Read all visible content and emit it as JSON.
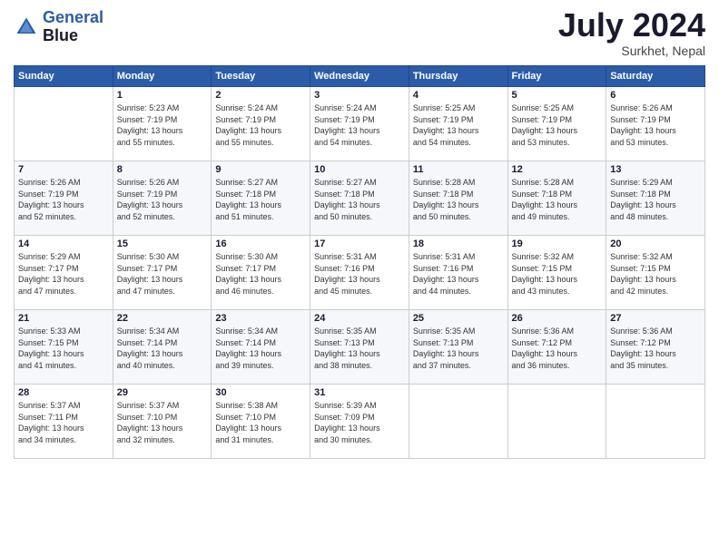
{
  "header": {
    "logo_line1": "General",
    "logo_line2": "Blue",
    "month": "July 2024",
    "location": "Surkhet, Nepal"
  },
  "weekdays": [
    "Sunday",
    "Monday",
    "Tuesday",
    "Wednesday",
    "Thursday",
    "Friday",
    "Saturday"
  ],
  "weeks": [
    [
      {
        "day": "",
        "info": ""
      },
      {
        "day": "1",
        "info": "Sunrise: 5:23 AM\nSunset: 7:19 PM\nDaylight: 13 hours\nand 55 minutes."
      },
      {
        "day": "2",
        "info": "Sunrise: 5:24 AM\nSunset: 7:19 PM\nDaylight: 13 hours\nand 55 minutes."
      },
      {
        "day": "3",
        "info": "Sunrise: 5:24 AM\nSunset: 7:19 PM\nDaylight: 13 hours\nand 54 minutes."
      },
      {
        "day": "4",
        "info": "Sunrise: 5:25 AM\nSunset: 7:19 PM\nDaylight: 13 hours\nand 54 minutes."
      },
      {
        "day": "5",
        "info": "Sunrise: 5:25 AM\nSunset: 7:19 PM\nDaylight: 13 hours\nand 53 minutes."
      },
      {
        "day": "6",
        "info": "Sunrise: 5:26 AM\nSunset: 7:19 PM\nDaylight: 13 hours\nand 53 minutes."
      }
    ],
    [
      {
        "day": "7",
        "info": "Sunrise: 5:26 AM\nSunset: 7:19 PM\nDaylight: 13 hours\nand 52 minutes."
      },
      {
        "day": "8",
        "info": "Sunrise: 5:26 AM\nSunset: 7:19 PM\nDaylight: 13 hours\nand 52 minutes."
      },
      {
        "day": "9",
        "info": "Sunrise: 5:27 AM\nSunset: 7:18 PM\nDaylight: 13 hours\nand 51 minutes."
      },
      {
        "day": "10",
        "info": "Sunrise: 5:27 AM\nSunset: 7:18 PM\nDaylight: 13 hours\nand 50 minutes."
      },
      {
        "day": "11",
        "info": "Sunrise: 5:28 AM\nSunset: 7:18 PM\nDaylight: 13 hours\nand 50 minutes."
      },
      {
        "day": "12",
        "info": "Sunrise: 5:28 AM\nSunset: 7:18 PM\nDaylight: 13 hours\nand 49 minutes."
      },
      {
        "day": "13",
        "info": "Sunrise: 5:29 AM\nSunset: 7:18 PM\nDaylight: 13 hours\nand 48 minutes."
      }
    ],
    [
      {
        "day": "14",
        "info": "Sunrise: 5:29 AM\nSunset: 7:17 PM\nDaylight: 13 hours\nand 47 minutes."
      },
      {
        "day": "15",
        "info": "Sunrise: 5:30 AM\nSunset: 7:17 PM\nDaylight: 13 hours\nand 47 minutes."
      },
      {
        "day": "16",
        "info": "Sunrise: 5:30 AM\nSunset: 7:17 PM\nDaylight: 13 hours\nand 46 minutes."
      },
      {
        "day": "17",
        "info": "Sunrise: 5:31 AM\nSunset: 7:16 PM\nDaylight: 13 hours\nand 45 minutes."
      },
      {
        "day": "18",
        "info": "Sunrise: 5:31 AM\nSunset: 7:16 PM\nDaylight: 13 hours\nand 44 minutes."
      },
      {
        "day": "19",
        "info": "Sunrise: 5:32 AM\nSunset: 7:15 PM\nDaylight: 13 hours\nand 43 minutes."
      },
      {
        "day": "20",
        "info": "Sunrise: 5:32 AM\nSunset: 7:15 PM\nDaylight: 13 hours\nand 42 minutes."
      }
    ],
    [
      {
        "day": "21",
        "info": "Sunrise: 5:33 AM\nSunset: 7:15 PM\nDaylight: 13 hours\nand 41 minutes."
      },
      {
        "day": "22",
        "info": "Sunrise: 5:34 AM\nSunset: 7:14 PM\nDaylight: 13 hours\nand 40 minutes."
      },
      {
        "day": "23",
        "info": "Sunrise: 5:34 AM\nSunset: 7:14 PM\nDaylight: 13 hours\nand 39 minutes."
      },
      {
        "day": "24",
        "info": "Sunrise: 5:35 AM\nSunset: 7:13 PM\nDaylight: 13 hours\nand 38 minutes."
      },
      {
        "day": "25",
        "info": "Sunrise: 5:35 AM\nSunset: 7:13 PM\nDaylight: 13 hours\nand 37 minutes."
      },
      {
        "day": "26",
        "info": "Sunrise: 5:36 AM\nSunset: 7:12 PM\nDaylight: 13 hours\nand 36 minutes."
      },
      {
        "day": "27",
        "info": "Sunrise: 5:36 AM\nSunset: 7:12 PM\nDaylight: 13 hours\nand 35 minutes."
      }
    ],
    [
      {
        "day": "28",
        "info": "Sunrise: 5:37 AM\nSunset: 7:11 PM\nDaylight: 13 hours\nand 34 minutes."
      },
      {
        "day": "29",
        "info": "Sunrise: 5:37 AM\nSunset: 7:10 PM\nDaylight: 13 hours\nand 32 minutes."
      },
      {
        "day": "30",
        "info": "Sunrise: 5:38 AM\nSunset: 7:10 PM\nDaylight: 13 hours\nand 31 minutes."
      },
      {
        "day": "31",
        "info": "Sunrise: 5:39 AM\nSunset: 7:09 PM\nDaylight: 13 hours\nand 30 minutes."
      },
      {
        "day": "",
        "info": ""
      },
      {
        "day": "",
        "info": ""
      },
      {
        "day": "",
        "info": ""
      }
    ]
  ]
}
